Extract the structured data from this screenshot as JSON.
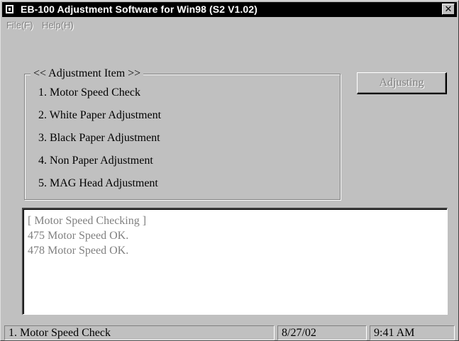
{
  "window": {
    "title": "EB-100 Adjustment Software for Win98 (S2 V1.02)",
    "close_symbol": "✕",
    "app_icon": "app-icon"
  },
  "menu": [
    {
      "label": "File(F)"
    },
    {
      "label": "Help(H)"
    }
  ],
  "adjustment": {
    "legend": "<< Adjustment Item >>",
    "items": [
      {
        "label": "1. Motor Speed Check"
      },
      {
        "label": "2. White Paper Adjustment"
      },
      {
        "label": "3. Black Paper Adjustment"
      },
      {
        "label": "4. Non Paper Adjustment"
      },
      {
        "label": "5. MAG Head Adjustment"
      }
    ]
  },
  "actions": {
    "adjusting_label": "Adjusting"
  },
  "log": {
    "lines": [
      "[ Motor Speed Checking ]",
      "475 Motor Speed OK.",
      "478 Motor Speed OK."
    ]
  },
  "status": {
    "current_item": "1. Motor Speed Check",
    "date": "8/27/02",
    "time": "9:41 AM"
  },
  "colors": {
    "face": "#c0c0c0",
    "disabled_text": "#808080",
    "title_bar": "#000000"
  }
}
